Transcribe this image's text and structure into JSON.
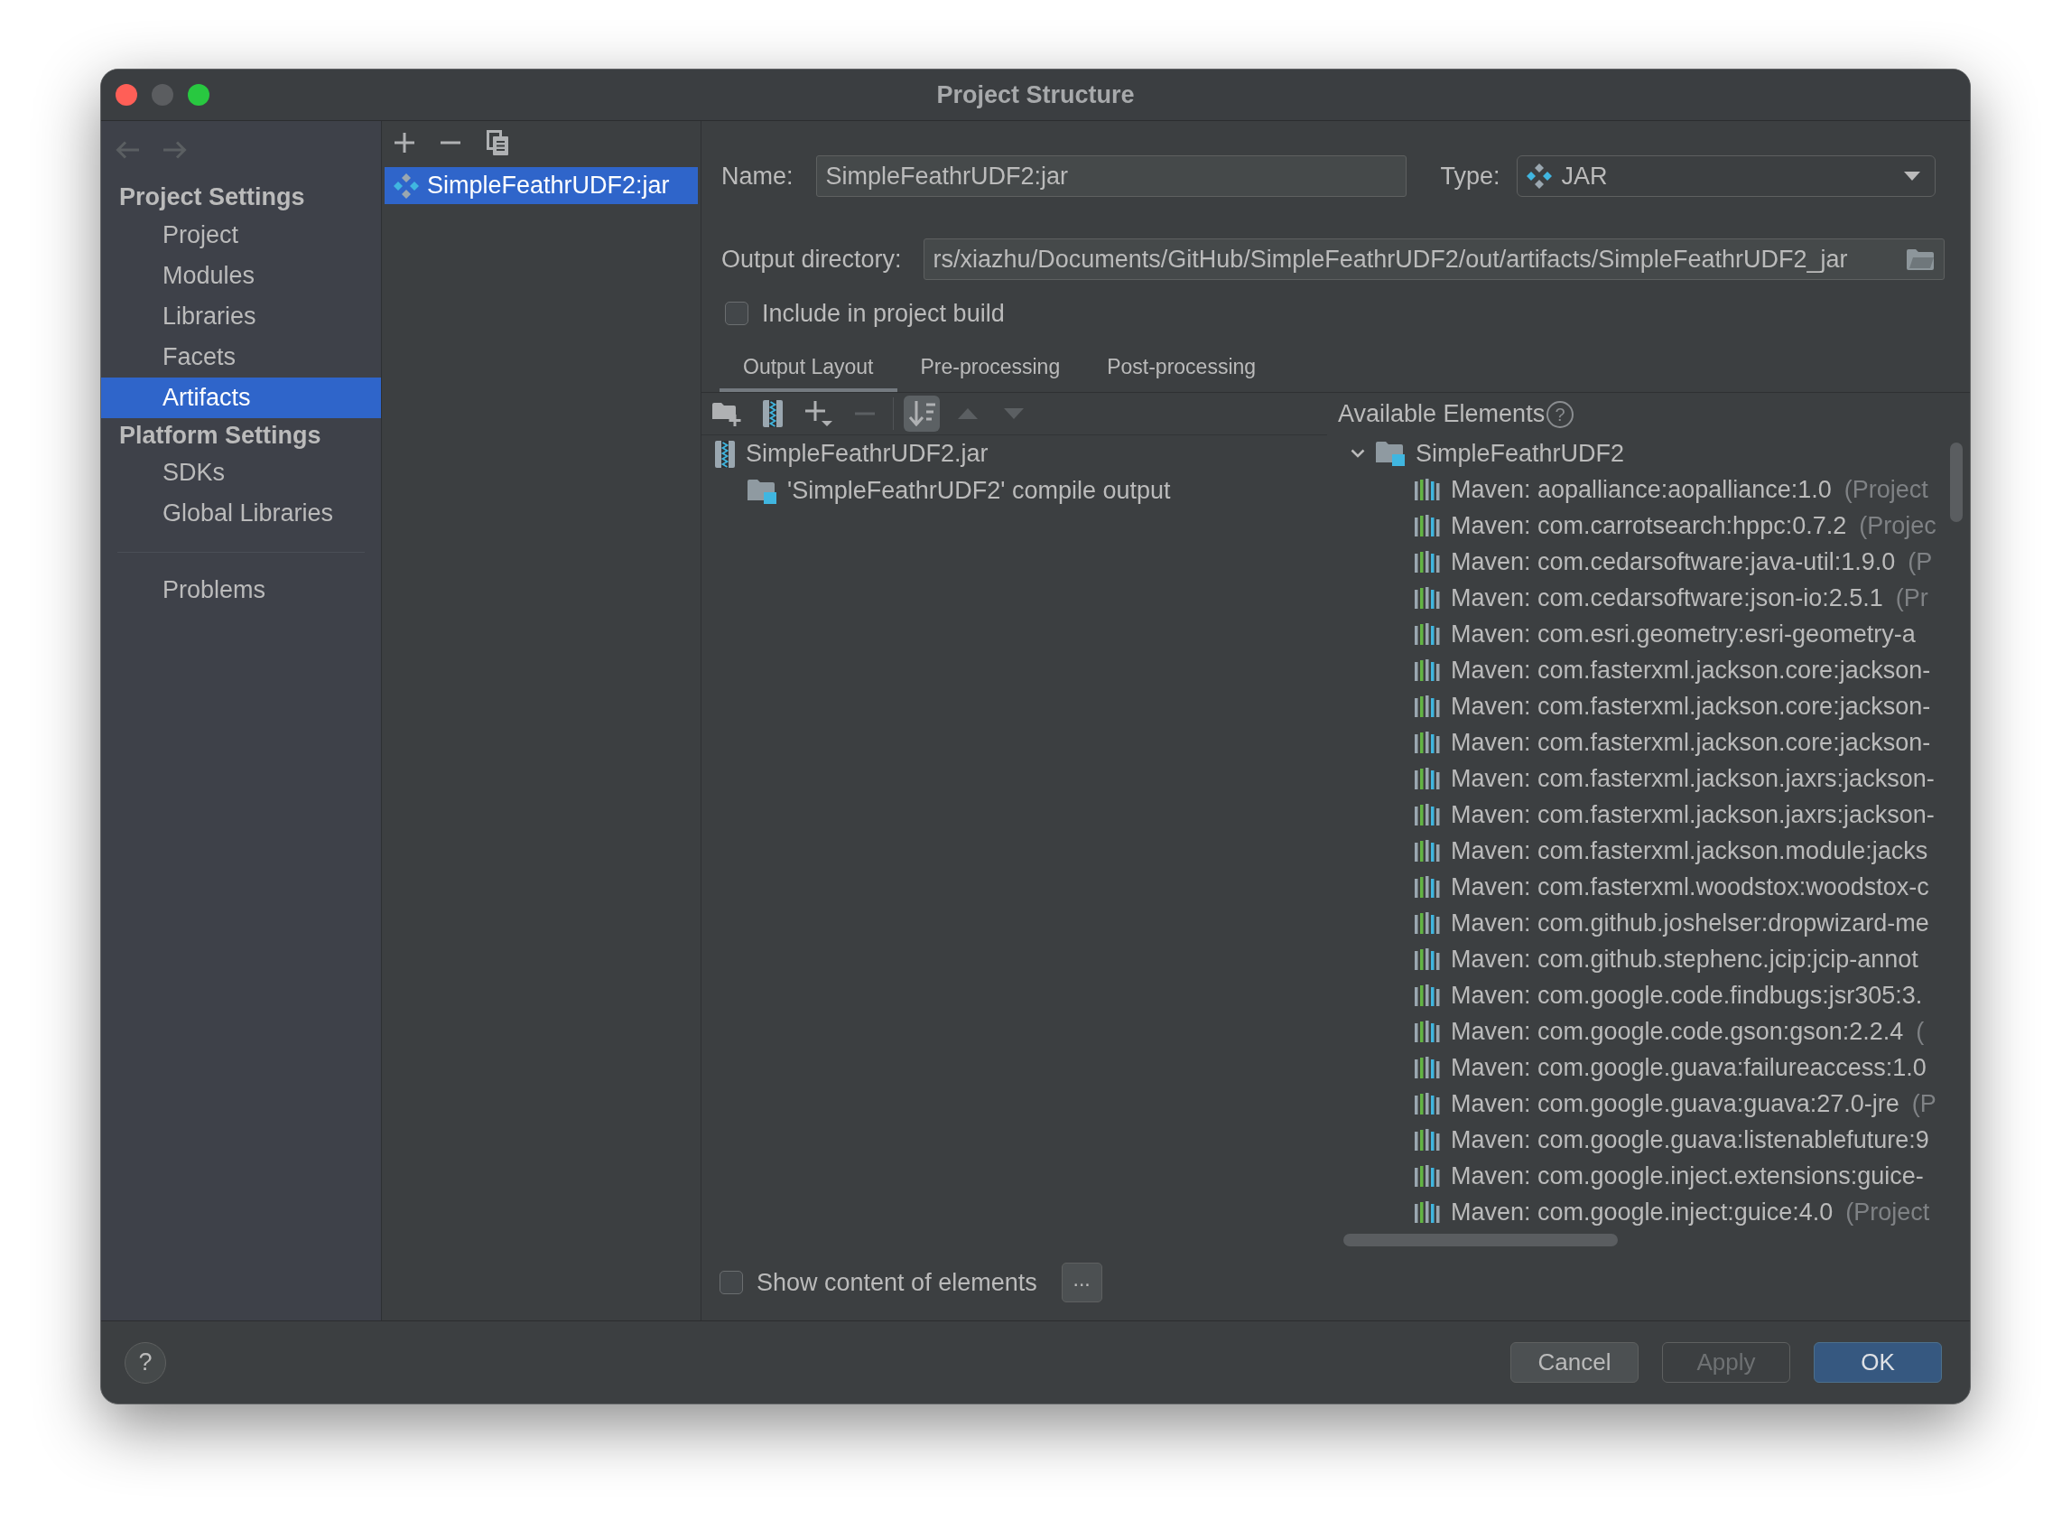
{
  "window": {
    "title": "Project Structure",
    "controls": [
      {
        "kind": "close",
        "disabled": false
      },
      {
        "kind": "minimize",
        "disabled": true
      },
      {
        "kind": "zoom",
        "disabled": false
      }
    ]
  },
  "navigation": [
    {
      "kind": "back",
      "disabled": true
    },
    {
      "kind": "forward",
      "disabled": true
    }
  ],
  "sidebar": {
    "sections": [
      {
        "heading": "Project Settings",
        "items": [
          {
            "label": "Project",
            "selected": false
          },
          {
            "label": "Modules",
            "selected": false
          },
          {
            "label": "Libraries",
            "selected": false
          },
          {
            "label": "Facets",
            "selected": false
          },
          {
            "label": "Artifacts",
            "selected": true
          }
        ]
      },
      {
        "heading": "Platform Settings",
        "items": [
          {
            "label": "SDKs",
            "selected": false
          },
          {
            "label": "Global Libraries",
            "selected": false
          }
        ]
      }
    ],
    "extra_items": [
      {
        "label": "Problems",
        "selected": false
      }
    ]
  },
  "artifact_list": {
    "toolbar": [
      {
        "kind": "add"
      },
      {
        "kind": "remove"
      },
      {
        "kind": "copy"
      }
    ],
    "items": [
      {
        "label": "SimpleFeathrUDF2:jar",
        "selected": true
      }
    ]
  },
  "name_field": {
    "label": "Name:",
    "value": "SimpleFeathrUDF2:jar"
  },
  "type_field": {
    "label": "Type:",
    "value": "JAR"
  },
  "output_directory": {
    "label": "Output directory:",
    "value": "rs/xiazhu/Documents/GitHub/SimpleFeathrUDF2/out/artifacts/SimpleFeathrUDF2_jar"
  },
  "include_in_build": {
    "label": "Include in project build",
    "checked": false
  },
  "tabs": [
    {
      "label": "Output Layout",
      "selected": true
    },
    {
      "label": "Pre-processing",
      "selected": false
    },
    {
      "label": "Post-processing",
      "selected": false
    }
  ],
  "layout_toolbar": [
    {
      "kind": "new-folder",
      "disabled": false,
      "on": false
    },
    {
      "kind": "archive",
      "disabled": false,
      "on": false
    },
    {
      "kind": "add-menu",
      "disabled": false,
      "on": false
    },
    {
      "kind": "remove",
      "disabled": true,
      "on": false
    },
    {
      "kind": "sort",
      "disabled": false,
      "on": true
    },
    {
      "kind": "move-up",
      "disabled": true,
      "on": false
    },
    {
      "kind": "move-down",
      "disabled": true,
      "on": false
    }
  ],
  "output_tree": [
    {
      "label": "SimpleFeathrUDF2.jar",
      "kind": "archive",
      "children": [
        {
          "label": "'SimpleFeathrUDF2' compile output",
          "kind": "module-output"
        }
      ]
    }
  ],
  "available_elements": {
    "title": "Available Elements",
    "help": "?",
    "tree": [
      {
        "label": "SimpleFeathrUDF2",
        "kind": "module",
        "expanded": true,
        "children": [
          {
            "label": "Maven: aopalliance:aopalliance:1.0",
            "note": "(Project",
            "kind": "library"
          },
          {
            "label": "Maven: com.carrotsearch:hppc:0.7.2",
            "note": "(Projec",
            "kind": "library"
          },
          {
            "label": "Maven: com.cedarsoftware:java-util:1.9.0",
            "note": "(P",
            "kind": "library"
          },
          {
            "label": "Maven: com.cedarsoftware:json-io:2.5.1",
            "note": "(Pr",
            "kind": "library"
          },
          {
            "label": "Maven: com.esri.geometry:esri-geometry-a",
            "kind": "library"
          },
          {
            "label": "Maven: com.fasterxml.jackson.core:jackson-",
            "kind": "library"
          },
          {
            "label": "Maven: com.fasterxml.jackson.core:jackson-",
            "kind": "library"
          },
          {
            "label": "Maven: com.fasterxml.jackson.core:jackson-",
            "kind": "library"
          },
          {
            "label": "Maven: com.fasterxml.jackson.jaxrs:jackson-",
            "kind": "library"
          },
          {
            "label": "Maven: com.fasterxml.jackson.jaxrs:jackson-",
            "kind": "library"
          },
          {
            "label": "Maven: com.fasterxml.jackson.module:jacks",
            "kind": "library"
          },
          {
            "label": "Maven: com.fasterxml.woodstox:woodstox-c",
            "kind": "library"
          },
          {
            "label": "Maven: com.github.joshelser:dropwizard-me",
            "kind": "library"
          },
          {
            "label": "Maven: com.github.stephenc.jcip:jcip-annot",
            "kind": "library"
          },
          {
            "label": "Maven: com.google.code.findbugs:jsr305:3.",
            "kind": "library"
          },
          {
            "label": "Maven: com.google.code.gson:gson:2.2.4",
            "note": "(",
            "kind": "library"
          },
          {
            "label": "Maven: com.google.guava:failureaccess:1.0",
            "kind": "library"
          },
          {
            "label": "Maven: com.google.guava:guava:27.0-jre",
            "note": "(P",
            "kind": "library"
          },
          {
            "label": "Maven: com.google.guava:listenablefuture:9",
            "kind": "library"
          },
          {
            "label": "Maven: com.google.inject.extensions:guice-",
            "kind": "library"
          },
          {
            "label": "Maven: com.google.inject:guice:4.0",
            "note": "(Project",
            "kind": "library"
          }
        ]
      }
    ]
  },
  "show_content": {
    "label": "Show content of elements",
    "checked": false
  },
  "more_button": "...",
  "help_button": "?",
  "buttons": [
    {
      "label": "Cancel",
      "kind": "secondary",
      "disabled": false
    },
    {
      "label": "Apply",
      "kind": "secondary",
      "disabled": true
    },
    {
      "label": "OK",
      "kind": "primary",
      "disabled": false
    }
  ]
}
